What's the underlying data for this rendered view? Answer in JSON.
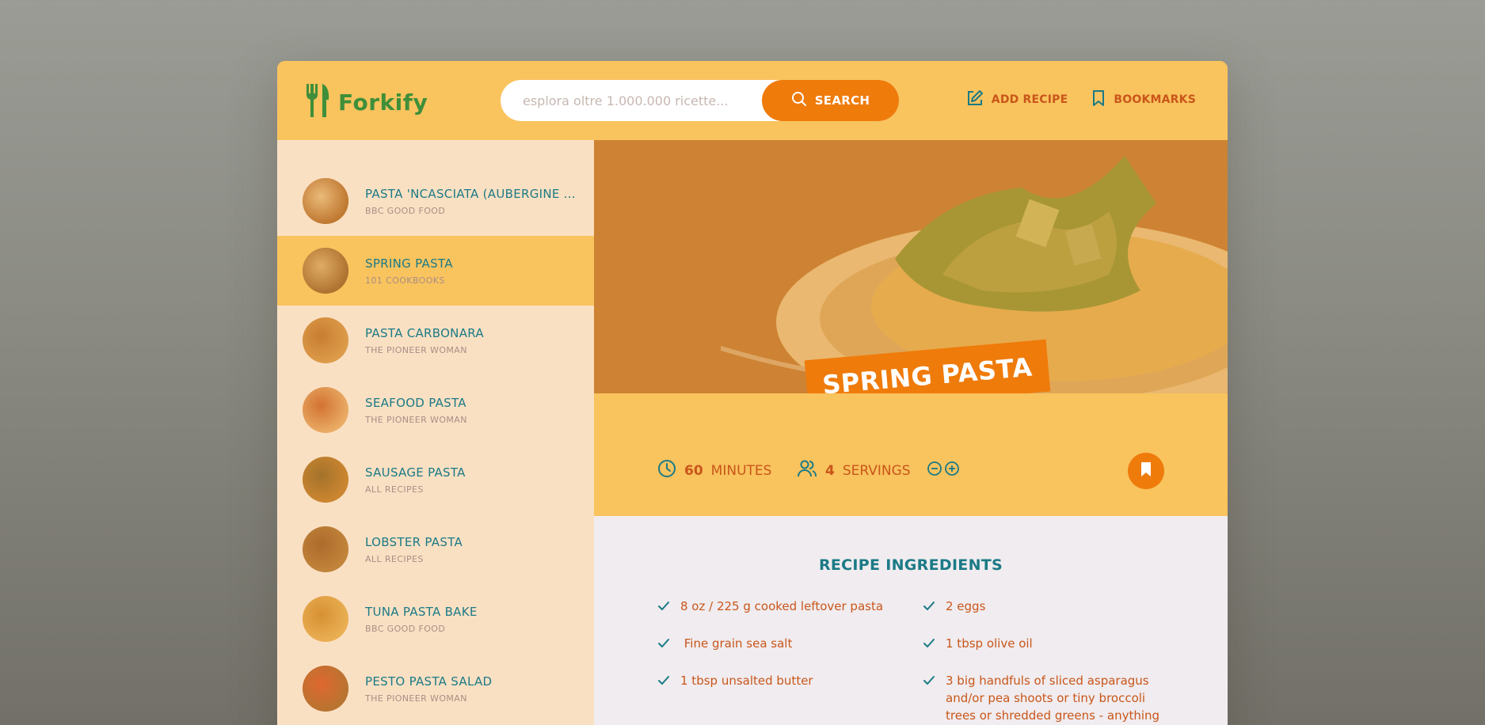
{
  "header": {
    "logo_text": "Forkify",
    "search_placeholder": "esplora oltre 1.000.000 ricette...",
    "search_button": "SEARCH",
    "nav": [
      {
        "label": "ADD RECIPE",
        "icon": "edit-icon"
      },
      {
        "label": "BOOKMARKS",
        "icon": "bookmark-icon"
      }
    ]
  },
  "results": [
    {
      "title": "PASTA 'NCASCIATA (AUBERGINE ...",
      "publisher": "BBC GOOD FOOD",
      "active": false,
      "colors": [
        "#a5642c",
        "#e8c89a"
      ]
    },
    {
      "title": "SPRING PASTA",
      "publisher": "101 COOKBOOKS",
      "active": true,
      "colors": [
        "#8c5a2a",
        "#d6b27a"
      ]
    },
    {
      "title": "PASTA CARBONARA",
      "publisher": "THE PIONEER WOMAN",
      "active": false,
      "colors": [
        "#d29a52",
        "#b36a2a"
      ]
    },
    {
      "title": "SEAFOOD PASTA",
      "publisher": "THE PIONEER WOMAN",
      "active": false,
      "colors": [
        "#e6b27c",
        "#c25a2c"
      ]
    },
    {
      "title": "SAUSAGE PASTA",
      "publisher": "ALL RECIPES",
      "active": false,
      "colors": [
        "#b9782a",
        "#7a5a22"
      ]
    },
    {
      "title": "LOBSTER PASTA",
      "publisher": "ALL RECIPES",
      "active": false,
      "colors": [
        "#a8763a",
        "#8a4e24"
      ]
    },
    {
      "title": "TUNA PASTA BAKE",
      "publisher": "BBC GOOD FOOD",
      "active": false,
      "colors": [
        "#e6b760",
        "#c9882e"
      ]
    },
    {
      "title": "PESTO PASTA SALAD",
      "publisher": "THE PIONEER WOMAN",
      "active": false,
      "colors": [
        "#9a5c2a",
        "#d64a2a"
      ]
    }
  ],
  "recipe": {
    "title": "SPRING PASTA",
    "cooking_time": "60",
    "time_unit": "MINUTES",
    "servings": "4",
    "servings_unit": "SERVINGS",
    "ingredients_heading": "RECIPE INGREDIENTS",
    "ingredients_left": [
      "8 oz / 225 g cooked leftover pasta",
      " Fine grain sea salt",
      "1 tbsp unsalted butter"
    ],
    "ingredients_right": [
      "2 eggs",
      "1 tbsp olive oil",
      "3 big handfuls of sliced asparagus and/or pea shoots or tiny broccoli trees or shredded greens - anything"
    ]
  },
  "colors": {
    "accent": "#ef7b0b",
    "header_bg": "#f9c35e",
    "sidebar_bg": "#fae0c3",
    "teal": "#1b7a86",
    "brand_green": "#3f8f3a"
  }
}
